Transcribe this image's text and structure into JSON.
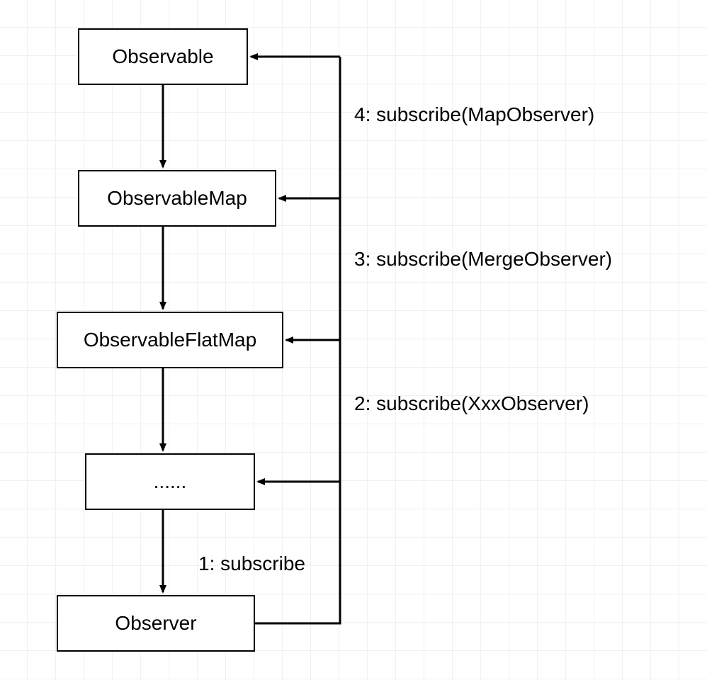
{
  "nodes": {
    "observable": "Observable",
    "observable_map": "ObservableMap",
    "observable_flatmap": "ObservableFlatMap",
    "ellipsis": "......",
    "observer": "Observer"
  },
  "labels": {
    "step4": "4: subscribe(MapObserver)",
    "step3": "3: subscribe(MergeObserver)",
    "step2": "2: subscribe(XxxObserver)",
    "step1": "1: subscribe"
  }
}
